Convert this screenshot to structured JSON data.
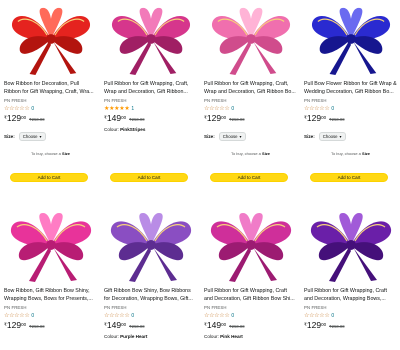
{
  "products": [
    {
      "title": "Bow Ribbon for Decoration, Pull Ribbon for Gift Wrapping, Craft, Wra...",
      "brand": "PN FRESH",
      "rating_stars": 0,
      "reviews": "0",
      "price_currency": "₹",
      "price_whole": "129",
      "price_fraction": "00",
      "mrp": "₹250.00",
      "colour_label": "",
      "colour_value": "",
      "size_label": "Size:",
      "size_value": "Choose",
      "hint_prefix": "To buy, choose a",
      "hint_bold": "Size",
      "cart_label": "Add to Cart",
      "bow_color": "#e5231f",
      "bow_dark": "#b3140f",
      "bow_light": "#ff6a5a"
    },
    {
      "title": "Pull Ribbon for Gift Wrapping, Craft, Wrap and Decoration, Gift Ribbon...",
      "brand": "PN FRESH",
      "rating_stars": 5,
      "reviews": "1",
      "price_currency": "₹",
      "price_whole": "149",
      "price_fraction": "00",
      "mrp": "₹250.00",
      "colour_label": "Colour:",
      "colour_value": "PinkStripes",
      "size_label": "",
      "size_value": "",
      "hint_prefix": "",
      "hint_bold": "",
      "cart_label": "Add to Cart",
      "bow_color": "#d6368c",
      "bow_dark": "#a01f64",
      "bow_light": "#f27ab9"
    },
    {
      "title": "Pull Ribbon for Gift Wrapping, Craft, Wrap and Decoration, Gift Ribbon Bo...",
      "brand": "PN FRESH",
      "rating_stars": 0,
      "reviews": "0",
      "price_currency": "₹",
      "price_whole": "129",
      "price_fraction": "00",
      "mrp": "₹250.00",
      "colour_label": "",
      "colour_value": "",
      "size_label": "Size:",
      "size_value": "Choose",
      "hint_prefix": "To buy, choose a",
      "hint_bold": "Size",
      "cart_label": "Add to Cart",
      "bow_color": "#f06fae",
      "bow_dark": "#d04c8c",
      "bow_light": "#ffb3d6"
    },
    {
      "title": "Pull Bow Flower Ribbon for Gift Wrap & Wedding Decoration, Gift Ribbon Bo...",
      "brand": "PN FRESH",
      "rating_stars": 0,
      "reviews": "0",
      "price_currency": "₹",
      "price_whole": "129",
      "price_fraction": "00",
      "mrp": "₹250.00",
      "colour_label": "",
      "colour_value": "",
      "size_label": "Size:",
      "size_value": "Choose",
      "hint_prefix": "To buy, choose a",
      "hint_bold": "Size",
      "cart_label": "Add to Cart",
      "bow_color": "#2a2ad0",
      "bow_dark": "#16168f",
      "bow_light": "#6a6af0"
    },
    {
      "title": "Bow Ribbon, Gift Ribbon Bow Shiny, Wrapping Bows, Bows for Presents,...",
      "brand": "PN FRESH",
      "rating_stars": 0,
      "reviews": "0",
      "price_currency": "₹",
      "price_whole": "129",
      "price_fraction": "00",
      "mrp": "₹250.00",
      "colour_label": "",
      "colour_value": "",
      "size_label": "",
      "size_value": "",
      "hint_prefix": "",
      "hint_bold": "",
      "cart_label": "",
      "bow_color": "#e8339a",
      "bow_dark": "#b81d74",
      "bow_light": "#ff7cc4"
    },
    {
      "title": "Gift Ribbon Bow Shiny, Bow Ribbons for Decoration, Wrapping Bows, Gift...",
      "brand": "PN FRESH",
      "rating_stars": 0,
      "reviews": "0",
      "price_currency": "₹",
      "price_whole": "149",
      "price_fraction": "00",
      "mrp": "₹250.00",
      "colour_label": "Colour:",
      "colour_value": "Purple Heart",
      "size_label": "",
      "size_value": "",
      "hint_prefix": "",
      "hint_bold": "",
      "cart_label": "",
      "bow_color": "#8a4ec2",
      "bow_dark": "#5d2d91",
      "bow_light": "#b98ce6"
    },
    {
      "title": "Pull Ribbon for Gift Wrapping, Craft and Decoration, Gift Ribbon Bow Shi...",
      "brand": "PN FRESH",
      "rating_stars": 0,
      "reviews": "0",
      "price_currency": "₹",
      "price_whole": "149",
      "price_fraction": "00",
      "mrp": "₹250.00",
      "colour_label": "Colour:",
      "colour_value": "Pink Heart",
      "size_label": "",
      "size_value": "",
      "hint_prefix": "",
      "hint_bold": "",
      "cart_label": "",
      "bow_color": "#cf2f9a",
      "bow_dark": "#9c1b72",
      "bow_light": "#f07cc8"
    },
    {
      "title": "Pull Ribbon for Gift Wrapping, Craft and Decoration, Wrapping Bows,...",
      "brand": "PN FRESH",
      "rating_stars": 0,
      "reviews": "0",
      "price_currency": "₹",
      "price_whole": "129",
      "price_fraction": "00",
      "mrp": "₹250.00",
      "colour_label": "",
      "colour_value": "",
      "size_label": "",
      "size_value": "",
      "hint_prefix": "",
      "hint_bold": "",
      "cart_label": "",
      "bow_color": "#6a1fa8",
      "bow_dark": "#45107a",
      "bow_light": "#a15ad8"
    }
  ]
}
